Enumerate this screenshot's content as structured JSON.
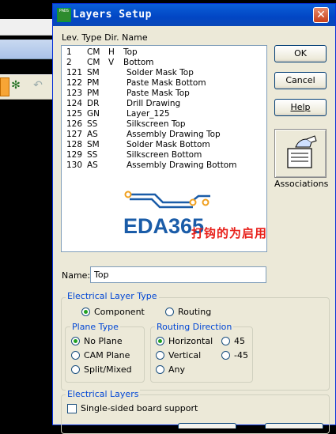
{
  "dialog": {
    "title": "Layers Setup",
    "title_icon_text": "PADS",
    "close_glyph": "✕"
  },
  "columns": {
    "header": "Lev.  Type  Dir.  Name"
  },
  "layers": [
    {
      "lev": "1",
      "type": "CM",
      "dir": "H",
      "name": "Top"
    },
    {
      "lev": "2",
      "type": "CM",
      "dir": "V",
      "name": "Bottom"
    },
    {
      "lev": "121",
      "type": "SM",
      "dir": "",
      "name": "Solder Mask Top"
    },
    {
      "lev": "122",
      "type": "PM",
      "dir": "",
      "name": "Paste Mask Bottom"
    },
    {
      "lev": "123",
      "type": "PM",
      "dir": "",
      "name": "Paste Mask Top"
    },
    {
      "lev": "124",
      "type": "DR",
      "dir": "",
      "name": "Drill Drawing"
    },
    {
      "lev": "125",
      "type": "GN",
      "dir": "",
      "name": "Layer_125"
    },
    {
      "lev": "126",
      "type": "SS",
      "dir": "",
      "name": "Silkscreen Top"
    },
    {
      "lev": "127",
      "type": "AS",
      "dir": "",
      "name": "Assembly Drawing Top"
    },
    {
      "lev": "128",
      "type": "SM",
      "dir": "",
      "name": "Solder Mask Bottom"
    },
    {
      "lev": "129",
      "type": "SS",
      "dir": "",
      "name": "Silkscreen Bottom"
    },
    {
      "lev": "130",
      "type": "AS",
      "dir": "",
      "name": "Assembly Drawing Bottom"
    }
  ],
  "logo": {
    "text": "EDA365",
    "color": "#1a5ca8",
    "accent": "#f0a020"
  },
  "watermark": "打钩的为启用",
  "buttons": {
    "ok": "OK",
    "cancel": "Cancel",
    "help": "Help"
  },
  "associations": {
    "label": "Associations"
  },
  "name": {
    "label": "Name:",
    "value": "Top"
  },
  "electrical_layer_type": {
    "legend": "Electrical  Layer Type",
    "options": [
      "Component",
      "Routing"
    ],
    "selected": "Component"
  },
  "plane_type": {
    "legend": "Plane Type",
    "options": [
      "No Plane",
      "CAM Plane",
      "Split/Mixed"
    ],
    "selected": "No Plane"
  },
  "routing_direction": {
    "legend": "Routing Direction",
    "options": [
      "Horizontal",
      "Vertical",
      "Any",
      "45",
      "-45"
    ],
    "selected": "Horizontal"
  },
  "electrical_layers": {
    "legend": "Electrical Layers",
    "single_sided_label": "Single-sided board support",
    "single_sided_checked": false
  }
}
